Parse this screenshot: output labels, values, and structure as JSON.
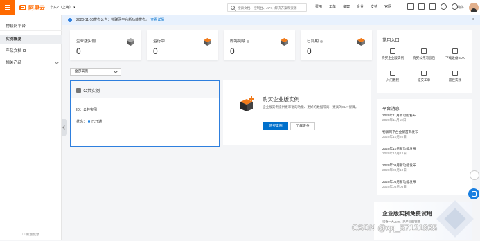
{
  "topbar": {
    "logo_text": "阿里云",
    "region": "华东2（上海）",
    "search_placeholder": "搜索文档、控制台、API、解决方案和资源",
    "nav": [
      "费用",
      "工单",
      "备案",
      "企业",
      "支持",
      "官网"
    ],
    "icons": [
      "terminal-icon",
      "bell-icon",
      "cart-icon",
      "help-icon",
      "globe-icon"
    ],
    "language": "简体",
    "brand_color": "#ff6a00"
  },
  "sidebar": {
    "title": "物联网平台",
    "items": [
      {
        "label": "实例概览",
        "active": true
      },
      {
        "label": "产品文档",
        "active": false,
        "external": true
      },
      {
        "label": "相关产品",
        "active": false,
        "expandable": true
      }
    ],
    "footer": "新版反馈"
  },
  "notice": {
    "text": "2020-11-10发布公告：物联网平台新功能发布。",
    "link": "查看详情"
  },
  "stats": [
    {
      "label": "企业版实例",
      "value": "0",
      "help": false,
      "icon": "enterprise-instance-icon"
    },
    {
      "label": "运行中",
      "value": "0",
      "help": false,
      "icon": "running-icon"
    },
    {
      "label": "即将到期",
      "value": "0",
      "help": true,
      "icon": "expiring-icon"
    },
    {
      "label": "已到期",
      "value": "0",
      "help": true,
      "icon": "expired-icon"
    }
  ],
  "filter": {
    "selected": "全部实例"
  },
  "public_instance": {
    "title": "公共实例",
    "id_label": "ID：公共实例",
    "status_label": "状态：",
    "status_value": "已开通",
    "status_color": "#1a7fe0"
  },
  "buy_card": {
    "title": "购买企业版实例",
    "desc": "企业版实例提供更丰富的功能、更好的数据隔离、更高的SLA 保障。",
    "primary_button": "购买实例",
    "secondary_button": "了解更多",
    "primary_color": "#0070cc"
  },
  "common_entries": {
    "title": "常用入口",
    "items": [
      {
        "label": "购买企业版实例",
        "icon": "shop-icon"
      },
      {
        "label": "购买公用消息包",
        "icon": "package-icon"
      },
      {
        "label": "下载设备SDK",
        "icon": "sdk-icon"
      },
      {
        "label": "入门教程",
        "icon": "tutorial-icon"
      },
      {
        "label": "提交工单",
        "icon": "ticket-icon"
      },
      {
        "label": "最佳实践",
        "icon": "practice-icon"
      }
    ]
  },
  "platform_news": {
    "title": "平台消息",
    "items": [
      {
        "title": "2020年11月新功能发布",
        "date": "2020年11月10日"
      },
      {
        "title": "物联网平台全新首页发布",
        "date": "2020年10月20日"
      },
      {
        "title": "2020年10月新功能发布",
        "date": "2020年10月12日"
      },
      {
        "title": "2020年09月新功能发布",
        "date": "2020年09月10日"
      },
      {
        "title": "2020年06月新功能发布",
        "date": "2020年08月06日"
      }
    ]
  },
  "promo": {
    "title": "企业版实例免费试用",
    "desc": "设备一天上云，资产自由管控"
  },
  "watermark": "CSDN @qq_57121935"
}
